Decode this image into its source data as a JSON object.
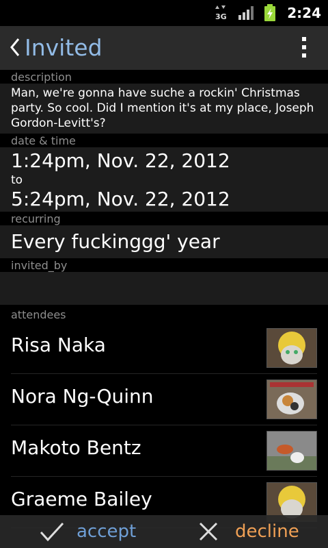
{
  "status_bar": {
    "network": "3G",
    "time": "2:24"
  },
  "header": {
    "title": "Invited"
  },
  "sections": {
    "description_label": "description",
    "description": "Man, we're gonna have suche a rockin' Christmas party. So cool. Did I mention it's at my place, Joseph Gordon-Levitt's?",
    "datetime_label": "date & time",
    "start": "1:24pm, Nov. 22, 2012",
    "to": "to",
    "end": "5:24pm, Nov. 22, 2012",
    "recurring_label": "recurring",
    "recurring": "Every fuckinggg' year",
    "invited_by_label": "invited_by",
    "invited_by": "",
    "attendees_label": "attendees"
  },
  "attendees": [
    {
      "name": "Risa Naka"
    },
    {
      "name": "Nora Ng-Quinn"
    },
    {
      "name": "Makoto Bentz"
    },
    {
      "name": "Graeme Bailey"
    }
  ],
  "bottom": {
    "accept": "accept",
    "decline": "decline"
  },
  "colors": {
    "title": "#92bbe6",
    "accept": "#6f9fd6",
    "decline": "#f0a055"
  }
}
